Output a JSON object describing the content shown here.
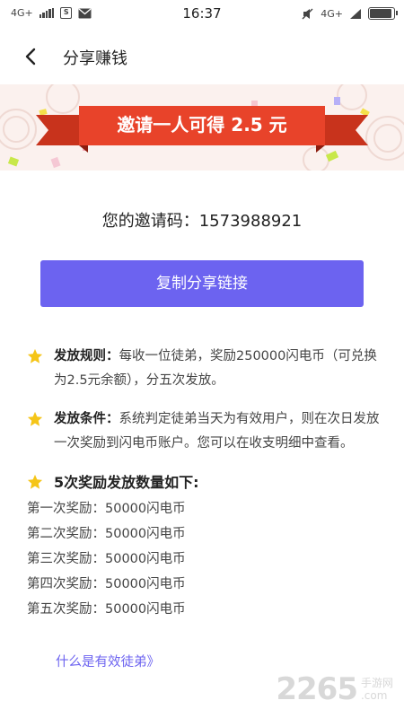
{
  "status_bar": {
    "network_left": "4G+",
    "time": "16:37",
    "network_right": "4G+",
    "battery_level": 0.95,
    "icons": [
      "signal-icon",
      "sim-s-icon",
      "mail-icon",
      "mute-icon",
      "wifi-icon",
      "battery-icon"
    ]
  },
  "nav": {
    "title": "分享赚钱",
    "back_icon": "chevron-left-icon"
  },
  "banner": {
    "ribbon_text": "邀请一人可得 2.5 元",
    "ribbon_color": "#e8432a"
  },
  "invite": {
    "label": "您的邀请码：",
    "code": "1573988921"
  },
  "copy_button": {
    "label": "复制分享链接",
    "color": "#6c63f0"
  },
  "rules": [
    {
      "title": "发放规则：",
      "text": "每收一位徒弟，奖励250000闪电币（可兑换为2.5元余额），分五次发放。"
    },
    {
      "title": "发放条件：",
      "text": "系统判定徒弟当天为有效用户，则在次日发放一次奖励到闪电币账户。您可以在收支明细中查看。"
    }
  ],
  "rewards": {
    "title": "5次奖励发放数量如下:",
    "items": [
      "第一次奖励：50000闪电币",
      "第二次奖励：50000闪电币",
      "第三次奖励：50000闪电币",
      "第四次奖励：50000闪电币",
      "第五次奖励：50000闪电币"
    ]
  },
  "link": {
    "label": "什么是有效徒弟》"
  },
  "watermark": {
    "number": "2265",
    "suffix": "手游网",
    "domain": ".com"
  }
}
